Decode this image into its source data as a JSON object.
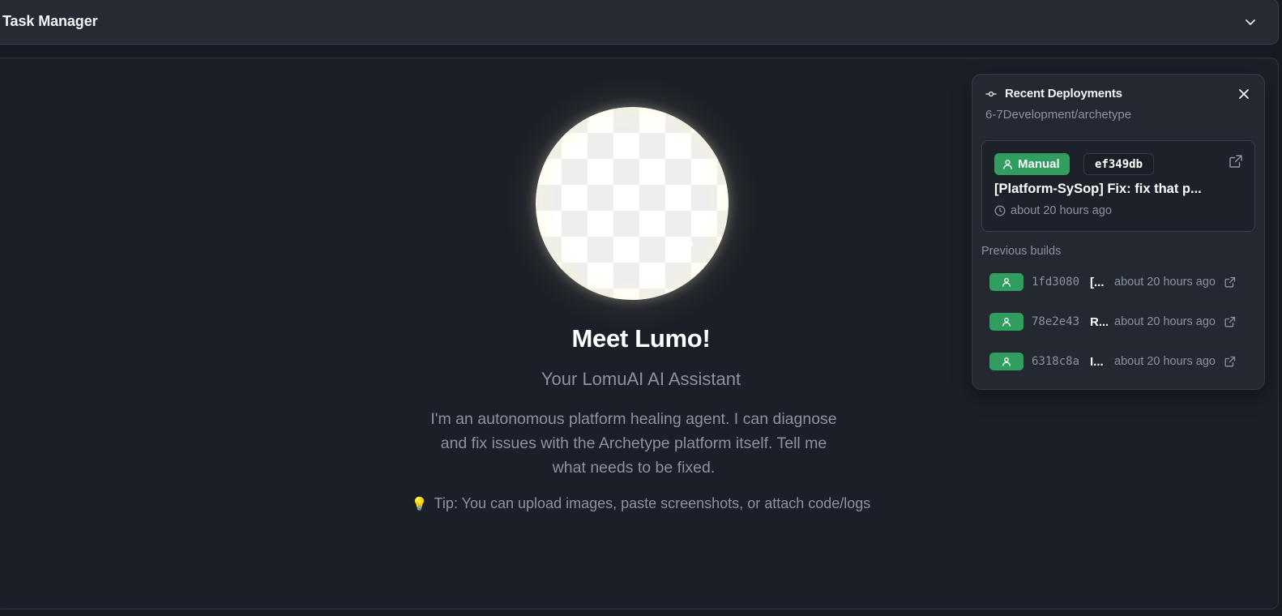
{
  "header": {
    "title": "Task Manager",
    "toggle_icon": "chevron-down-icon"
  },
  "hero": {
    "avatar_icon": "lumo-orb",
    "title": "Meet Lumo!",
    "subtitle": "Your LomuAI AI Assistant",
    "description": "I'm an autonomous platform healing agent. I can diagnose and fix issues with the Archetype platform itself. Tell me what needs to be fixed.",
    "tip_icon": "💡",
    "tip": "Tip: You can upload images, paste screenshots, or attach code/logs"
  },
  "deployments": {
    "title": "Recent Deployments",
    "repo": "6-7Development/archetype",
    "latest": {
      "trigger_label": "Manual",
      "hash": "ef349db",
      "message": "[Platform-SySop] Fix: fix that p...",
      "time": "about 20 hours ago"
    },
    "previous_label": "Previous builds",
    "previous": [
      {
        "hash": "1fd3080",
        "message": "[...",
        "time": "about 20 hours ago"
      },
      {
        "hash": "78e2e43",
        "message": "R...",
        "time": "about 20 hours ago"
      },
      {
        "hash": "6318c8a",
        "message": "I...",
        "time": "about 20 hours ago"
      }
    ]
  },
  "colors": {
    "background": "#161a21",
    "panel": "#232831",
    "success_green": "#2f9e5e",
    "muted_text": "#8b93a1"
  }
}
